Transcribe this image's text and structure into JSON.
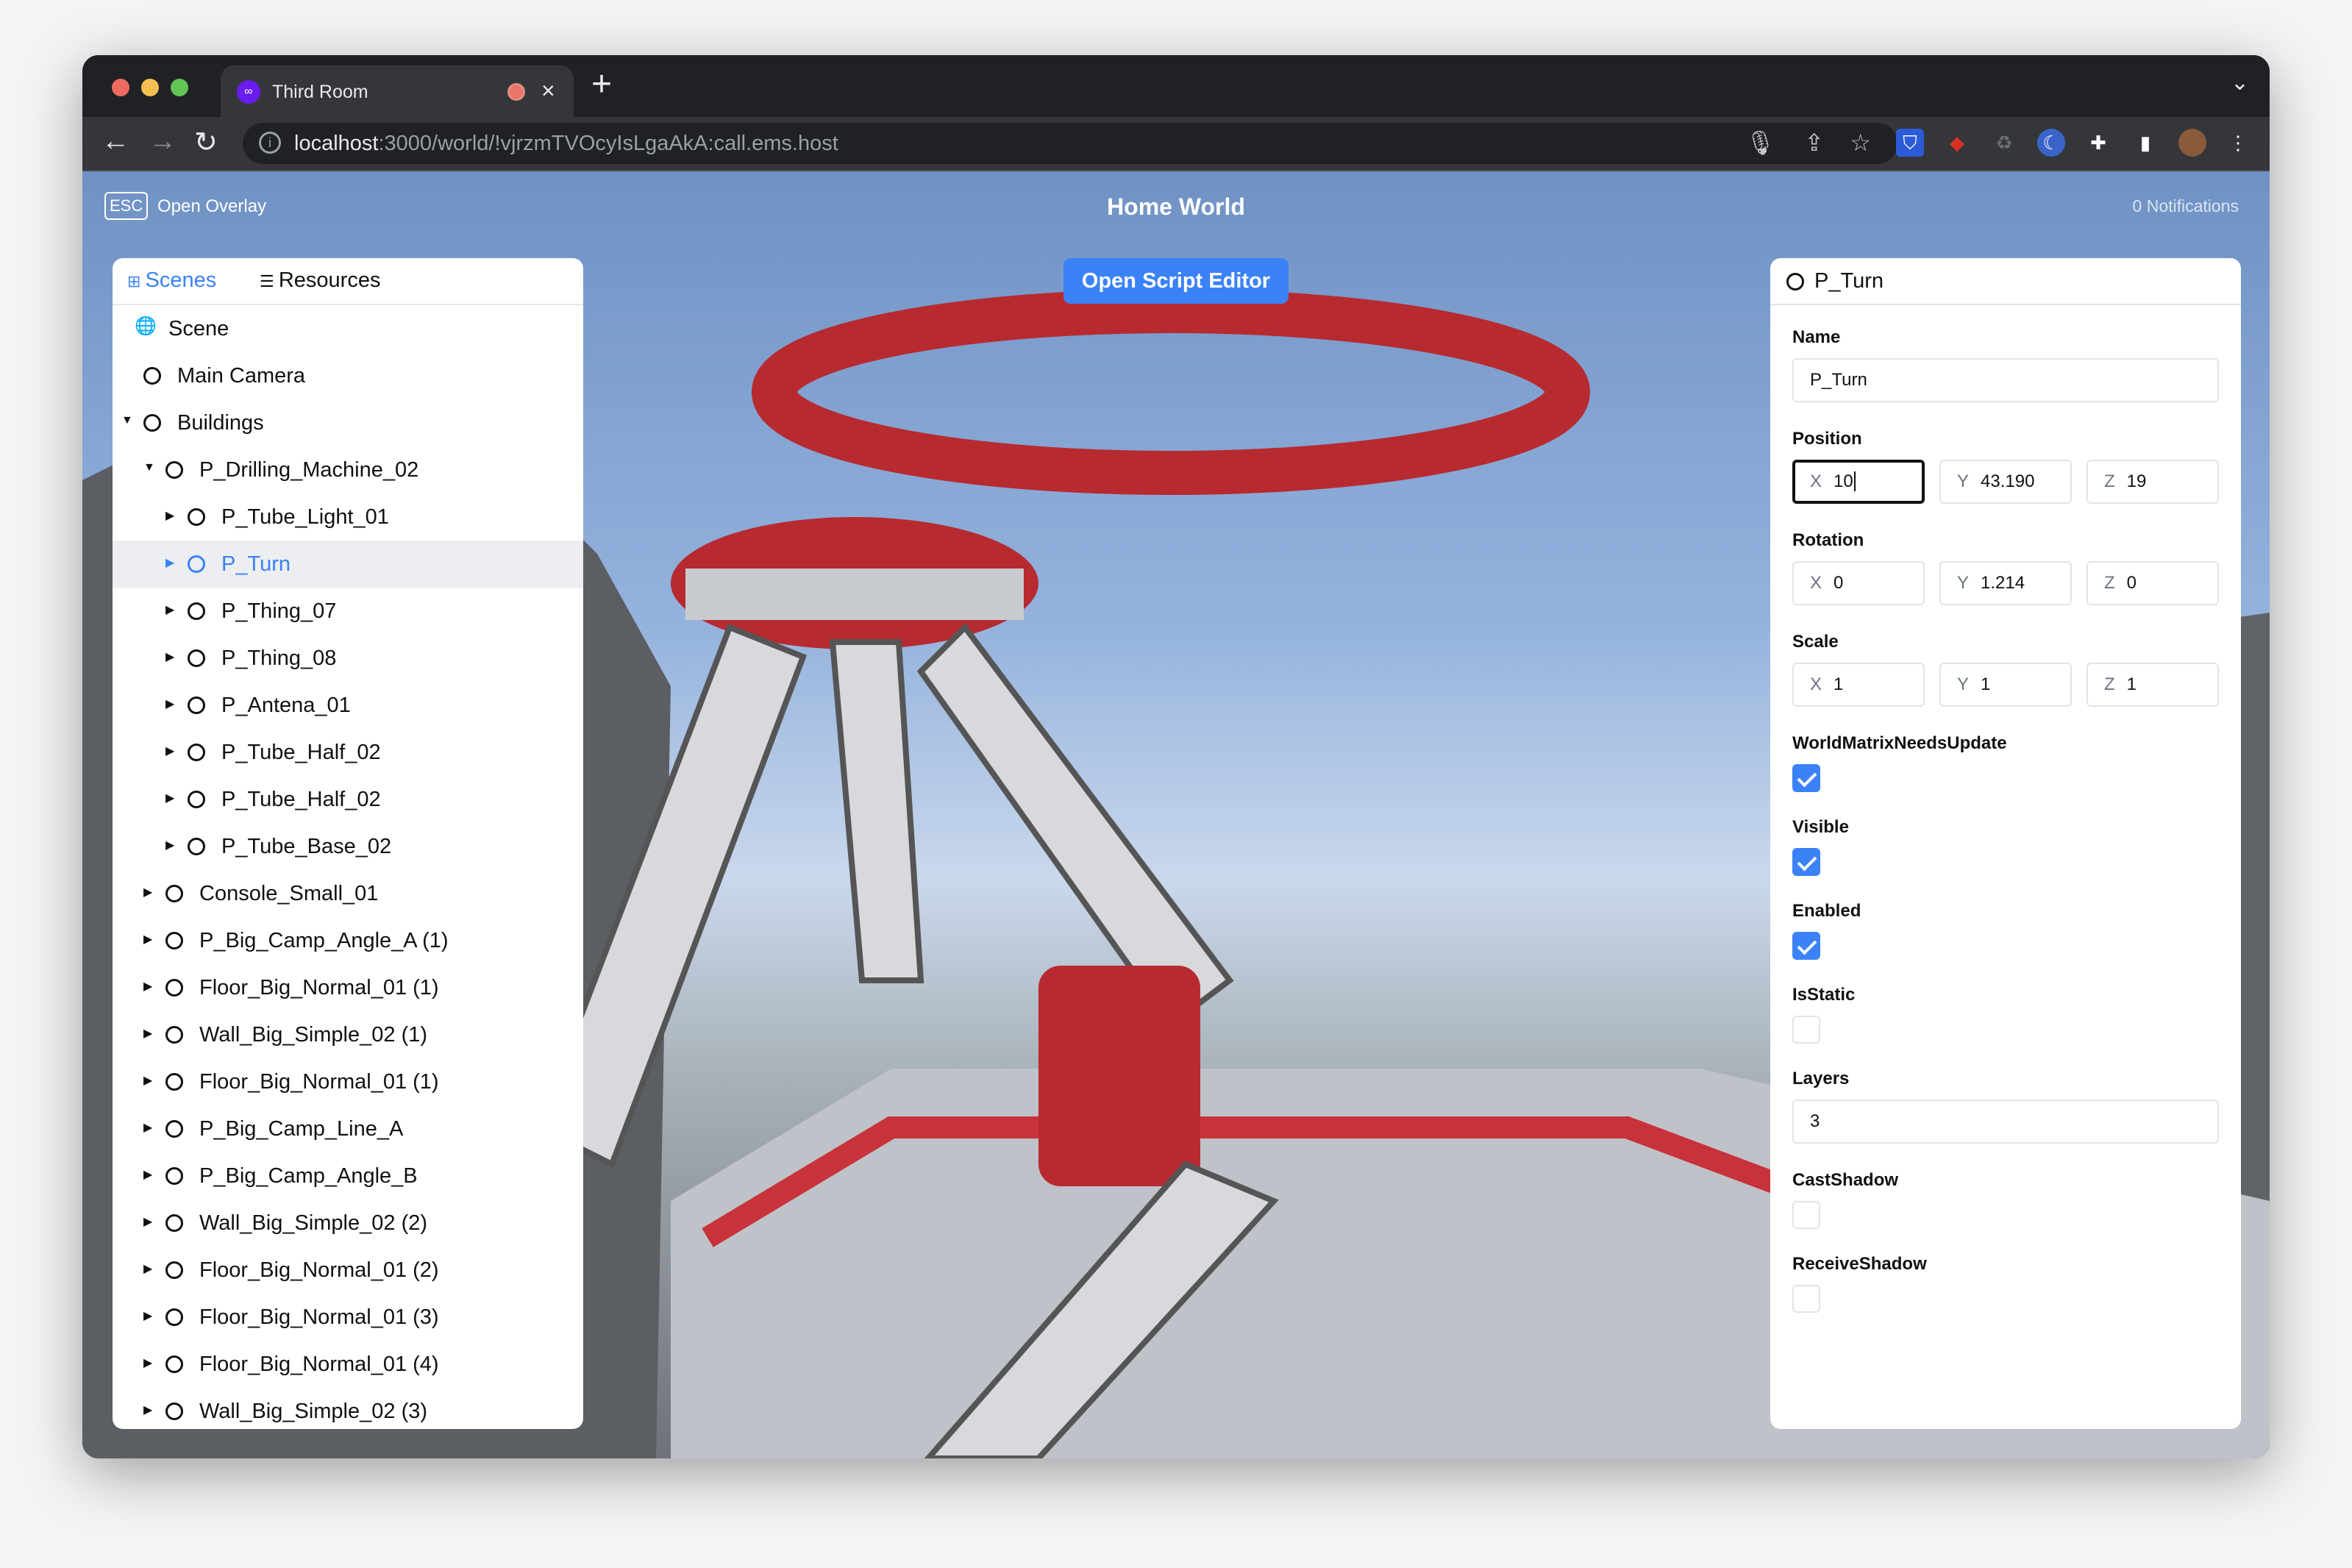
{
  "browser": {
    "tab_title": "Third Room",
    "url_host": "localhost",
    "url_rest": ":3000/world/!vjrzmTVOcyIsLgaAkA:call.ems.host"
  },
  "overlay": {
    "esc_key": "ESC",
    "open_overlay": "Open Overlay",
    "world_title": "Home World",
    "notifications": "0 Notifications",
    "script_editor": "Open Script Editor"
  },
  "colors": {
    "accent": "#3b82f6",
    "selected_row": "#eceef1"
  },
  "left_panel": {
    "tabs": [
      {
        "label": "Scenes",
        "icon": "hierarchy-icon",
        "active": true
      },
      {
        "label": "Resources",
        "icon": "list-icon",
        "active": false
      }
    ],
    "tree": [
      {
        "label": "Scene",
        "level": 0,
        "icon": "globe-icon",
        "arrow": ""
      },
      {
        "label": "Main Camera",
        "level": 1,
        "arrow": ""
      },
      {
        "label": "Buildings",
        "level": 1,
        "arrow": "down"
      },
      {
        "label": "P_Drilling_Machine_02",
        "level": 2,
        "arrow": "down"
      },
      {
        "label": "P_Tube_Light_01",
        "level": 3,
        "arrow": "right"
      },
      {
        "label": "P_Turn",
        "level": 3,
        "arrow": "right",
        "selected": true
      },
      {
        "label": "P_Thing_07",
        "level": 3,
        "arrow": "right"
      },
      {
        "label": "P_Thing_08",
        "level": 3,
        "arrow": "right"
      },
      {
        "label": "P_Antena_01",
        "level": 3,
        "arrow": "right"
      },
      {
        "label": "P_Tube_Half_02",
        "level": 3,
        "arrow": "right"
      },
      {
        "label": "P_Tube_Half_02",
        "level": 3,
        "arrow": "right"
      },
      {
        "label": "P_Tube_Base_02",
        "level": 3,
        "arrow": "right"
      },
      {
        "label": "Console_Small_01",
        "level": 2,
        "arrow": "right"
      },
      {
        "label": "P_Big_Camp_Angle_A (1)",
        "level": 2,
        "arrow": "right"
      },
      {
        "label": "Floor_Big_Normal_01 (1)",
        "level": 2,
        "arrow": "right"
      },
      {
        "label": "Wall_Big_Simple_02 (1)",
        "level": 2,
        "arrow": "right"
      },
      {
        "label": "Floor_Big_Normal_01 (1)",
        "level": 2,
        "arrow": "right"
      },
      {
        "label": "P_Big_Camp_Line_A",
        "level": 2,
        "arrow": "right"
      },
      {
        "label": "P_Big_Camp_Angle_B",
        "level": 2,
        "arrow": "right"
      },
      {
        "label": "Wall_Big_Simple_02 (2)",
        "level": 2,
        "arrow": "right"
      },
      {
        "label": "Floor_Big_Normal_01 (2)",
        "level": 2,
        "arrow": "right"
      },
      {
        "label": "Floor_Big_Normal_01 (3)",
        "level": 2,
        "arrow": "right"
      },
      {
        "label": "Floor_Big_Normal_01 (4)",
        "level": 2,
        "arrow": "right"
      },
      {
        "label": "Wall_Big_Simple_02 (3)",
        "level": 2,
        "arrow": "right"
      }
    ]
  },
  "inspector": {
    "title": "P_Turn",
    "name_label": "Name",
    "name_value": "P_Turn",
    "position_label": "Position",
    "position": {
      "x": "10",
      "y": "43.190",
      "z": "19"
    },
    "rotation_label": "Rotation",
    "rotation": {
      "x": "0",
      "y": "1.214",
      "z": "0"
    },
    "scale_label": "Scale",
    "scale": {
      "x": "1",
      "y": "1",
      "z": "1"
    },
    "axes": {
      "x": "X",
      "y": "Y",
      "z": "Z"
    },
    "flags": [
      {
        "label": "WorldMatrixNeedsUpdate",
        "checked": true
      },
      {
        "label": "Visible",
        "checked": true
      },
      {
        "label": "Enabled",
        "checked": true
      },
      {
        "label": "IsStatic",
        "checked": false
      }
    ],
    "layers_label": "Layers",
    "layers_value": "3",
    "flags2": [
      {
        "label": "CastShadow",
        "checked": false
      },
      {
        "label": "ReceiveShadow",
        "checked": false
      }
    ]
  }
}
